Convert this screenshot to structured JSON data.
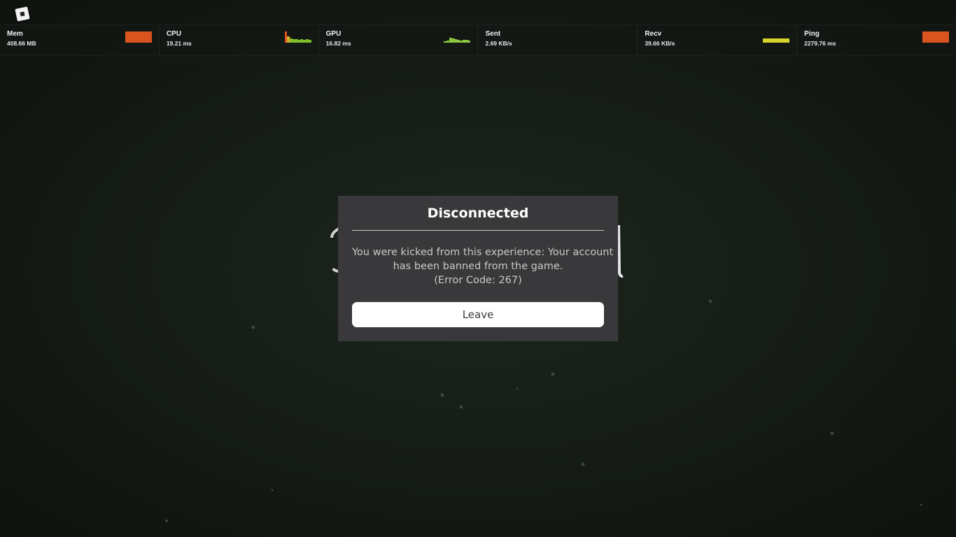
{
  "menu": {
    "icon": "roblox-logo-icon"
  },
  "stats": [
    {
      "label": "Mem",
      "value": "408.66 MB",
      "graph": [
        1,
        1,
        1,
        1,
        1,
        1,
        1,
        1,
        1,
        1
      ],
      "color": "#d9541e"
    },
    {
      "label": "CPU",
      "value": "19.21 ms",
      "graph": [
        1.0,
        0.55,
        0.4,
        0.32,
        0.3,
        0.28,
        0.32,
        0.25,
        0.3,
        0.28
      ],
      "color": "#7fbf2a"
    },
    {
      "label": "GPU",
      "value": "16.82 ms",
      "graph": [
        0.12,
        0.18,
        0.45,
        0.38,
        0.3,
        0.22,
        0.2,
        0.25,
        0.22,
        0.2
      ],
      "color": "#8cc63f"
    },
    {
      "label": "Sent",
      "value": "2.69 KB/s",
      "graph": [],
      "color": "#8cc63f"
    },
    {
      "label": "Recv",
      "value": "39.66 KB/s",
      "graph": [
        0.38,
        0.38,
        0.38,
        0.38,
        0.38,
        0.38,
        0.38,
        0.38,
        0.38,
        0.38
      ],
      "color": "#d4d42a"
    },
    {
      "label": "Ping",
      "value": "2279.76 ms",
      "graph": [
        1,
        1,
        1,
        1,
        1,
        1,
        1,
        1,
        1,
        1
      ],
      "color": "#d9541e"
    }
  ],
  "dialog": {
    "title": "Disconnected",
    "message_line1": "You were kicked from this experience: Your account",
    "message_line2": "has been banned from the game.",
    "message_line3": "(Error Code: 267)",
    "leave_label": "Leave"
  },
  "colors": {
    "dialog_bg": "#39393b",
    "button_bg": "#ffffff",
    "page_bg": "#161c17"
  }
}
